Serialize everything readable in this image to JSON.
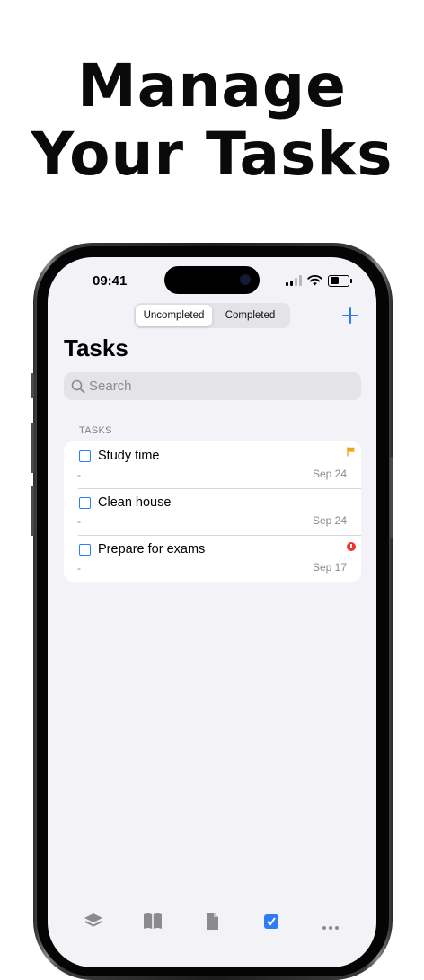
{
  "headline": {
    "line1": "Manage",
    "line2": "Your Tasks"
  },
  "status_bar": {
    "time": "09:41",
    "battery_level": 0.6
  },
  "segmented_control": {
    "options": [
      {
        "label": "Uncompleted",
        "selected": true
      },
      {
        "label": "Completed",
        "selected": false
      }
    ]
  },
  "toolbar": {
    "add_icon": "plus-icon"
  },
  "page": {
    "title": "Tasks"
  },
  "search": {
    "placeholder": "Search"
  },
  "section": {
    "header": "TASKS"
  },
  "tasks": [
    {
      "title": "Study time",
      "note": "-",
      "date": "Sep 24",
      "marker": "flag"
    },
    {
      "title": "Clean house",
      "note": "-",
      "date": "Sep 24",
      "marker": "none"
    },
    {
      "title": "Prepare for exams",
      "note": "-",
      "date": "Sep 17",
      "marker": "alert"
    }
  ],
  "colors": {
    "accent": "#2f7bf5",
    "flag": "#f5a21b",
    "alert": "#f2332f",
    "background": "#f2f2f7"
  },
  "tab_bar": {
    "items": [
      {
        "icon": "layers-icon"
      },
      {
        "icon": "book-icon"
      },
      {
        "icon": "document-icon"
      },
      {
        "icon": "checkbox-icon",
        "selected": true
      },
      {
        "icon": "more-icon"
      }
    ]
  }
}
